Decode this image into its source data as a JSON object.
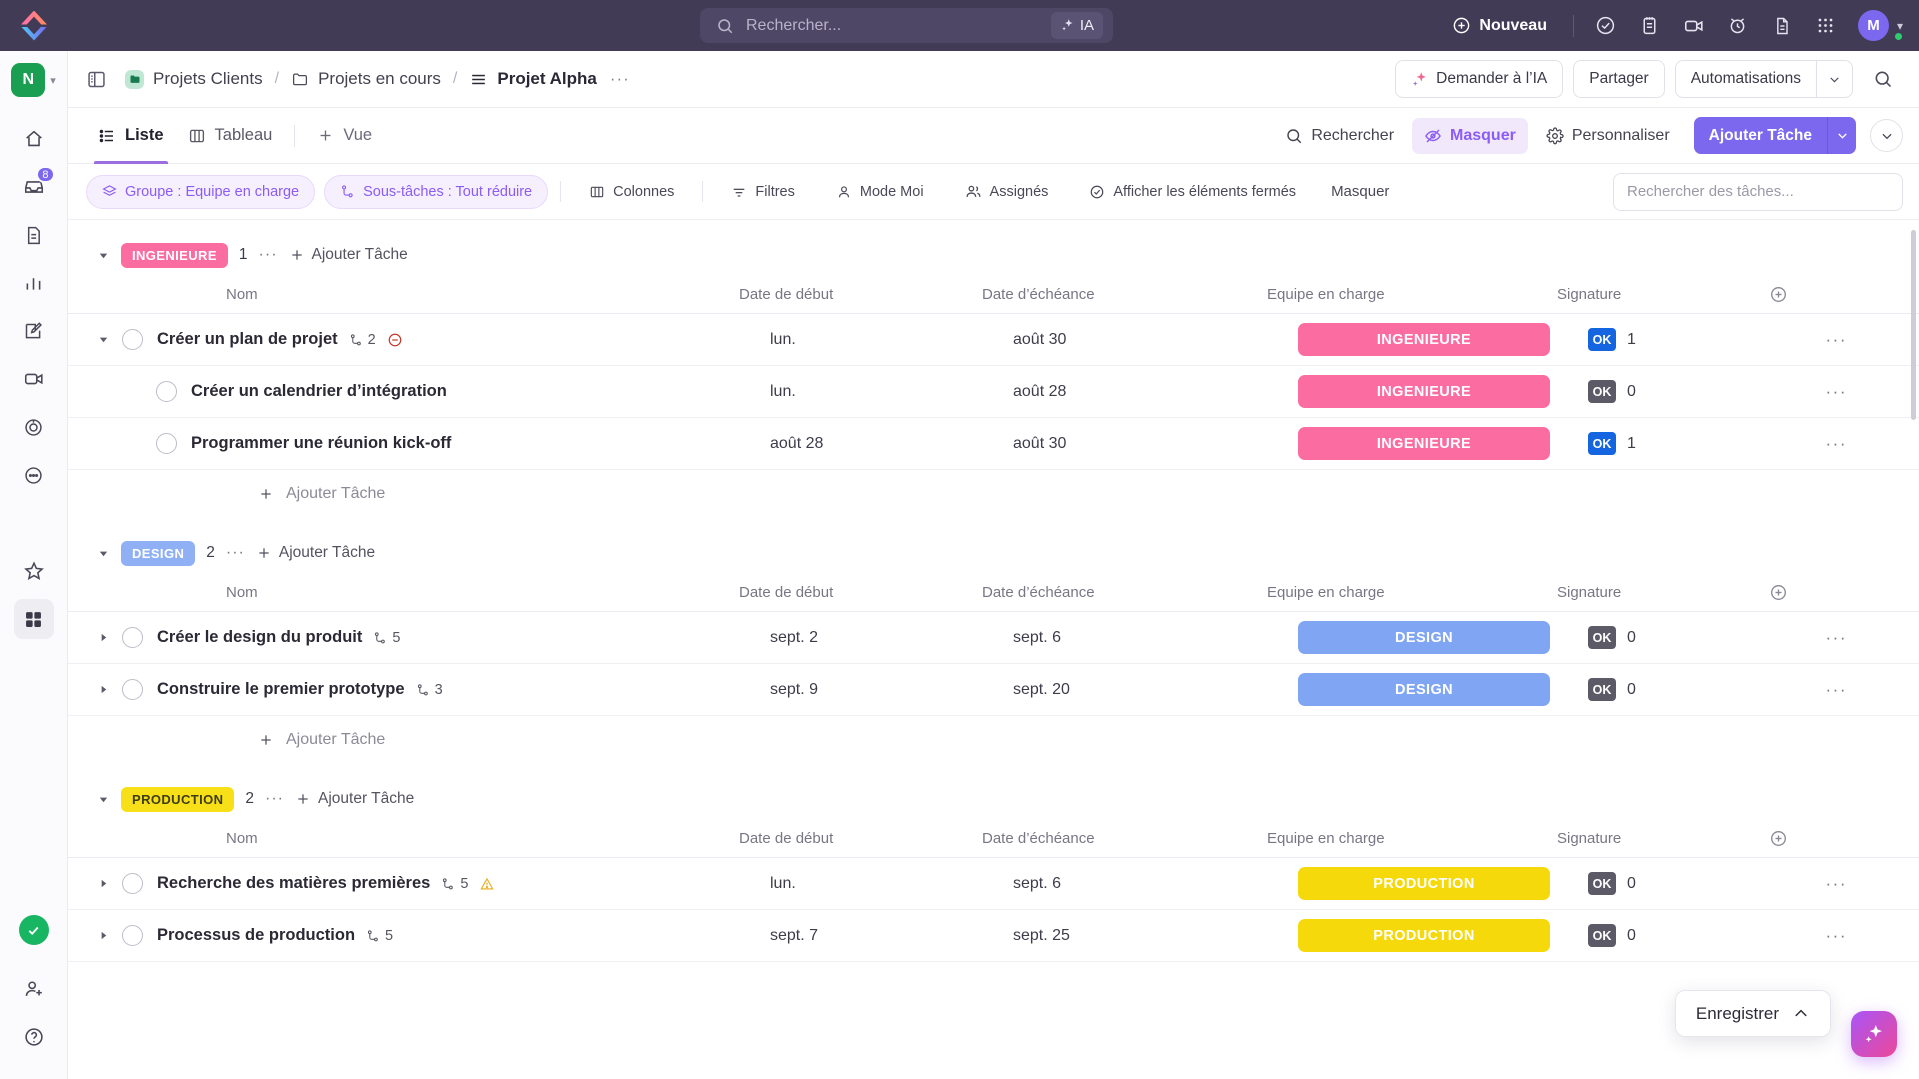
{
  "topbar": {
    "logo_name": "clickup-logo",
    "search_placeholder": "Rechercher...",
    "ai_label": "IA",
    "new_label": "Nouveau",
    "icons": [
      "check-circle-icon",
      "clipboard-icon",
      "video-camera-icon",
      "alarm-clock-icon",
      "document-icon",
      "apps-grid-icon"
    ],
    "avatar_initial": "M"
  },
  "sidebar": {
    "workspace_initial": "N",
    "items": [
      {
        "name": "home-icon",
        "badge": ""
      },
      {
        "name": "inbox-icon",
        "badge": "8"
      },
      {
        "name": "docs-icon",
        "badge": ""
      },
      {
        "name": "dashboards-icon",
        "badge": ""
      },
      {
        "name": "whiteboards-icon",
        "badge": ""
      },
      {
        "name": "clips-icon",
        "badge": ""
      },
      {
        "name": "goals-icon",
        "badge": ""
      },
      {
        "name": "more-icon",
        "badge": ""
      }
    ],
    "favorites_icon": "star-icon",
    "apps_icon": "grid-apps-icon",
    "status_icon": "green-check-icon",
    "invite_icon": "invite-user-icon",
    "help_icon": "help-icon"
  },
  "breadcrumb": {
    "panel_toggle": "toggle-sidebar-icon",
    "items": [
      {
        "label": "Projets Clients",
        "icon": "space-icon"
      },
      {
        "label": "Projets en cours",
        "icon": "folder-icon"
      },
      {
        "label": "Projet Alpha",
        "icon": "list-icon"
      }
    ],
    "separator": "/",
    "more": "···",
    "ask_ai": "Demander à l’IA",
    "share": "Partager",
    "automations": "Automatisations",
    "search_icon": "search-icon"
  },
  "viewbar": {
    "tabs": [
      {
        "label": "Liste",
        "icon": "list-view-icon",
        "active": true
      },
      {
        "label": "Tableau",
        "icon": "board-view-icon",
        "active": false
      },
      {
        "label": "Vue",
        "icon": "plus-icon",
        "active": false
      }
    ],
    "search": "Rechercher",
    "hide": "Masquer",
    "customize": "Personnaliser",
    "add_task": "Ajouter Tâche",
    "caret": "∨"
  },
  "filterbar": {
    "chips": [
      {
        "label": "Groupe : Equipe en charge",
        "icon": "layers-icon",
        "style": "purple"
      },
      {
        "label": "Sous-tâches : Tout réduire",
        "icon": "subtask-icon",
        "style": "purple"
      },
      {
        "label": "Colonnes",
        "icon": "columns-icon",
        "style": "plain"
      },
      {
        "label": "Filtres",
        "icon": "filter-icon",
        "style": "plain"
      },
      {
        "label": "Mode Moi",
        "icon": "person-icon",
        "style": "plain"
      },
      {
        "label": "Assignés",
        "icon": "people-icon",
        "style": "plain"
      },
      {
        "label": "Afficher les éléments fermés",
        "icon": "check-circle-icon",
        "style": "plain"
      }
    ],
    "hide_label": "Masquer",
    "search_placeholder": "Rechercher des tâches..."
  },
  "columns": {
    "name": "Nom",
    "start": "Date de début",
    "due": "Date d’échéance",
    "team": "Equipe en charge",
    "signature": "Signature",
    "add_column_icon": "add-column-icon"
  },
  "add_task_row": "Ajouter Tâche",
  "group_add_task": "Ajouter Tâche",
  "groups": [
    {
      "tag": "INGENIEURE",
      "tag_bg": "#fb6ca0",
      "tag_fg": "#ffffff",
      "pill_bg": "#fb6ca0",
      "count": "1",
      "tasks": [
        {
          "name": "Créer un plan de projet",
          "indent": 0,
          "expander": "down",
          "subtask_count": "2",
          "badge_icon": "blocked-icon",
          "start": "lun.",
          "due": "août 30",
          "team": "INGENIEURE",
          "sig_label": "OK",
          "sig_style": "blue",
          "sig_count": "1"
        },
        {
          "name": "Créer un calendrier d’intégration",
          "indent": 1,
          "expander": "none",
          "subtask_count": "",
          "badge_icon": "",
          "start": "lun.",
          "due": "août 28",
          "team": "INGENIEURE",
          "sig_label": "OK",
          "sig_style": "gray",
          "sig_count": "0"
        },
        {
          "name": "Programmer une réunion kick-off",
          "indent": 1,
          "expander": "none",
          "subtask_count": "",
          "badge_icon": "",
          "start": "août 28",
          "due": "août 30",
          "team": "INGENIEURE",
          "sig_label": "OK",
          "sig_style": "blue",
          "sig_count": "1"
        }
      ]
    },
    {
      "tag": "DESIGN",
      "tag_bg": "#8fb0f5",
      "tag_fg": "#ffffff",
      "pill_bg": "#7fa5f3",
      "count": "2",
      "tasks": [
        {
          "name": "Créer le design du produit",
          "indent": 0,
          "expander": "right",
          "subtask_count": "5",
          "badge_icon": "",
          "start": "sept. 2",
          "due": "sept. 6",
          "team": "DESIGN",
          "sig_label": "OK",
          "sig_style": "gray",
          "sig_count": "0"
        },
        {
          "name": "Construire le premier prototype",
          "indent": 0,
          "expander": "right",
          "subtask_count": "3",
          "badge_icon": "",
          "start": "sept. 9",
          "due": "sept. 20",
          "team": "DESIGN",
          "sig_label": "OK",
          "sig_style": "gray",
          "sig_count": "0"
        }
      ]
    },
    {
      "tag": "PRODUCTION",
      "tag_bg": "#f7e018",
      "tag_fg": "#3f3c13",
      "pill_bg": "#f5d90a",
      "count": "2",
      "tasks": [
        {
          "name": "Recherche des matières premières",
          "indent": 0,
          "expander": "right",
          "subtask_count": "5",
          "badge_icon": "warning-icon",
          "start": "lun.",
          "due": "sept. 6",
          "team": "PRODUCTION",
          "sig_label": "OK",
          "sig_style": "gray",
          "sig_count": "0"
        },
        {
          "name": "Processus de production",
          "indent": 0,
          "expander": "right",
          "subtask_count": "5",
          "badge_icon": "",
          "start": "sept. 7",
          "due": "sept. 25",
          "team": "PRODUCTION",
          "sig_label": "OK",
          "sig_style": "gray",
          "sig_count": "0"
        }
      ]
    }
  ],
  "footer": {
    "save_label": "Enregistrer",
    "save_caret_icon": "chevron-up-icon",
    "ai_fab_icon": "ai-sparkle-icon"
  }
}
